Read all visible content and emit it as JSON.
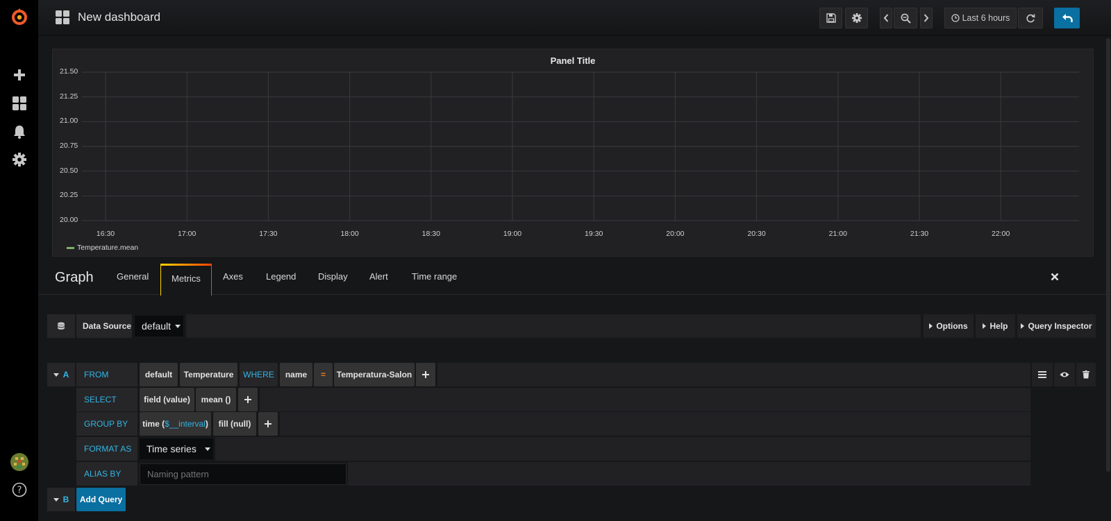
{
  "topbar": {
    "title": "New dashboard",
    "time_range": "Last 6 hours"
  },
  "panel": {
    "title": "Panel Title",
    "legend": "Temperature.mean"
  },
  "chart_data": {
    "type": "line",
    "title": "Panel Title",
    "xlabel": "",
    "ylabel": "",
    "x_ticks": [
      "16:30",
      "17:00",
      "17:30",
      "18:00",
      "18:30",
      "19:00",
      "19:30",
      "20:00",
      "20:30",
      "21:00",
      "21:30",
      "22:00"
    ],
    "y_ticks": [
      "21.50",
      "21.25",
      "21.00",
      "20.75",
      "20.50",
      "20.25",
      "20.00"
    ],
    "ylim": [
      20.0,
      21.5
    ],
    "grid": true,
    "legend_position": "bottom-left",
    "series": [
      {
        "name": "Temperature.mean",
        "values": [],
        "color": "#7eb26d"
      }
    ]
  },
  "editor": {
    "title": "Graph",
    "tabs": [
      "General",
      "Metrics",
      "Axes",
      "Legend",
      "Display",
      "Alert",
      "Time range"
    ],
    "active_tab": "Metrics",
    "data_source_label": "Data Source",
    "data_source_value": "default",
    "options_label": "Options",
    "help_label": "Help",
    "query_inspector_label": "Query Inspector"
  },
  "query_a": {
    "letter": "A",
    "from_label": "FROM",
    "policy": "default",
    "measurement": "Temperature",
    "where_label": "WHERE",
    "tag_key": "name",
    "operator": "=",
    "tag_value": "Temperatura-Salon",
    "select_label": "SELECT",
    "select_field": "field (value)",
    "select_fn": "mean ()",
    "group_by_label": "GROUP BY",
    "group_time_prefix": "time (",
    "group_time_var": "$__interval",
    "group_time_suffix": ")",
    "group_fill": "fill (null)",
    "format_as_label": "FORMAT AS",
    "format_as_value": "Time series",
    "alias_by_label": "ALIAS BY",
    "alias_placeholder": "Naming pattern"
  },
  "query_b": {
    "letter": "B",
    "add_query_label": "Add Query"
  },
  "colors": {
    "accent_blue": "#33b5e5",
    "primary_button": "#0a6fa1",
    "series_green": "#7eb26d"
  }
}
